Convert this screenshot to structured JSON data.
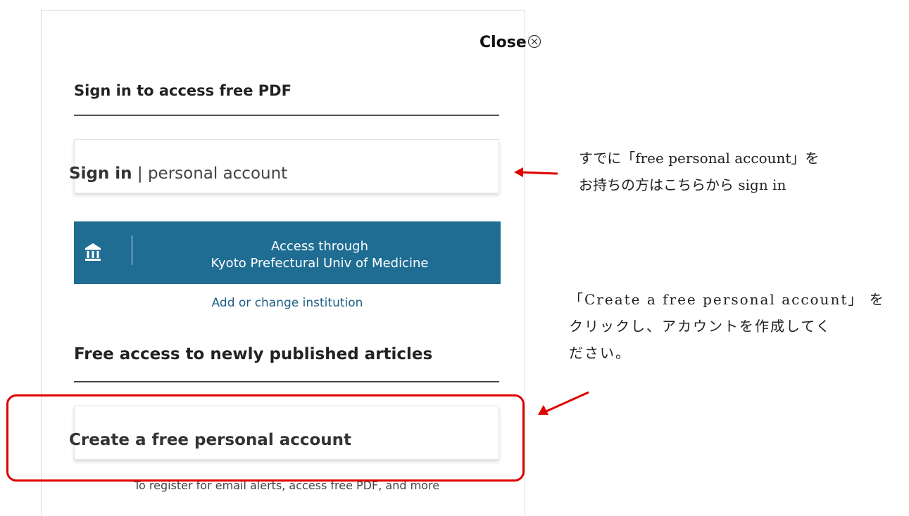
{
  "dialog": {
    "close_label": "Close",
    "heading_signin": "Sign in to access free PDF",
    "signin_strong": "Sign in",
    "signin_sep": "|",
    "signin_rest": "personal account",
    "institution_line1": "Access through",
    "institution_line2": "Kyoto Prefectural Univ of Medicine",
    "add_institution": "Add or change institution",
    "heading_free": "Free access to newly published articles",
    "create_account": "Create a free personal account",
    "register_note": "To register for email alerts, access free PDF, and more"
  },
  "annotations": {
    "note1_line1": "すでに「free personal account」を",
    "note1_line2": "お持ちの方はこちらから sign in",
    "note2_line1": "「Create a free personal account」 を",
    "note2_line2": "クリックし、アカウントを作成してく",
    "note2_line3": "ださい。"
  },
  "colors": {
    "institution_button": "#1f6d93",
    "link": "#1d5f84",
    "highlight": "#e00000"
  },
  "icons": {
    "close": "close-circle-x-icon",
    "institution": "bank-building-icon"
  }
}
